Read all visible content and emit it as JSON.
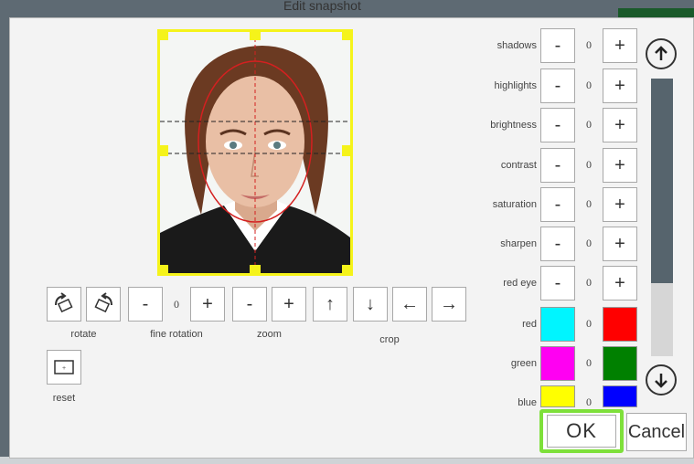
{
  "window_title": "Edit snapshot",
  "photo_tools": {
    "rotate_label": "rotate",
    "fine_rotation_label": "fine rotation",
    "fine_rotation_value": "0",
    "zoom_label": "zoom",
    "crop_label": "crop",
    "reset_label": "reset",
    "minus": "-",
    "plus": "+"
  },
  "adjustments": [
    {
      "label": "shadows",
      "value": "0"
    },
    {
      "label": "highlights",
      "value": "0"
    },
    {
      "label": "brightness",
      "value": "0"
    },
    {
      "label": "contrast",
      "value": "0"
    },
    {
      "label": "saturation",
      "value": "0"
    },
    {
      "label": "sharpen",
      "value": "0"
    },
    {
      "label": "red eye",
      "value": "0"
    }
  ],
  "color_balance": [
    {
      "label": "red",
      "value": "0",
      "left_color": "#00f5ff",
      "right_color": "#ff0000"
    },
    {
      "label": "green",
      "value": "0",
      "left_color": "#ff00f2",
      "right_color": "#008000"
    },
    {
      "label": "blue",
      "value": "0",
      "left_color": "#ffff00",
      "right_color": "#0000ff"
    }
  ],
  "buttons": {
    "ok": "OK",
    "cancel": "Cancel"
  },
  "colors": {
    "highlight": "#7ee03a",
    "frame": "#f5f31a",
    "scroll_thumb": "#56646d"
  }
}
